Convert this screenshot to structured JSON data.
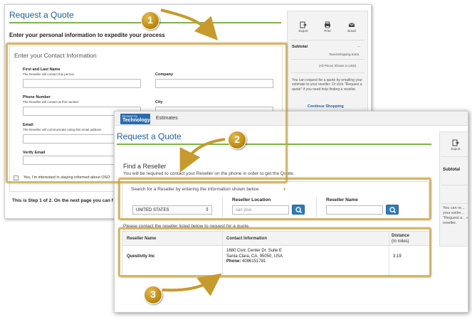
{
  "back_window": {
    "title": "Request a Quote",
    "subtitle": "Enter your personal information to expedite your process",
    "contact_caption": "Enter your Contact Information",
    "fields": {
      "name_label": "First and Last Name",
      "name_sub": "The Reseller will contact this person",
      "company_label": "Company",
      "phone_label": "Phone Number",
      "phone_sub": "The Reseller will contact at this number",
      "city_label": "City",
      "email_label": "Email",
      "email_sub": "The Reseller will communicate using this email address",
      "verify_label": "Verify Email"
    },
    "checkbox_label": "Yes, I'm interested in staying informed about OSO",
    "step_text": "This is Step 1 of 2. On the next page you can f",
    "sidebar": {
      "tools": [
        "Export",
        "Print",
        "Email"
      ],
      "subtotal_label": "Subtotal",
      "subtotal_value": "--",
      "tax_note": "Taxes/Shipping Extra",
      "prices_note": "(All Prices Shown in USD)",
      "help_text": "You can request for a quote by emailing your estimate to your reseller. Or click \"Request a quote\" if you need help finding a reseller.",
      "continue_label": "Continue Shopping"
    }
  },
  "front_window": {
    "nav": {
      "browse_top": "Browse by",
      "browse_bottom": "Technology",
      "estimates": "Estimates"
    },
    "title": "Request a Quote",
    "find_title": "Find a Reseller",
    "find_desc": "You will be required to contact your Reseller on the phone in order to get the Quote.",
    "search_hint": "Search for a Reseller by entering the information shown below.",
    "country_value": "UNITED STATES",
    "location_label": "Reseller Location",
    "location_value": "san jose",
    "name_label": "Reseller Name",
    "name_value": "",
    "contact_msg": "Please contact the reseller listed below to request for a quote.",
    "table": {
      "headers": [
        "Reseller Name",
        "Contact Information",
        "Distance",
        "(In miles)"
      ],
      "row": {
        "name": "Questivity Inc",
        "address1": "1680 Civic Center Dr. Suite E",
        "address2": "Santa Clara, CA, 95050, USA",
        "phone_label": "Phone:",
        "phone": "4086151781",
        "distance": "3.19"
      }
    },
    "sidebar": {
      "export": "Export",
      "subtotal_label": "Subtotal",
      "help_text": "You can re... your estim... \"Request a... a reseller."
    }
  },
  "annotations": [
    "1",
    "2",
    "3"
  ],
  "colors": {
    "link_blue": "#1f5fa3",
    "accent_green": "#7ab648",
    "highlight_gold": "#c8a032",
    "button_blue": "#2f7ab8"
  }
}
